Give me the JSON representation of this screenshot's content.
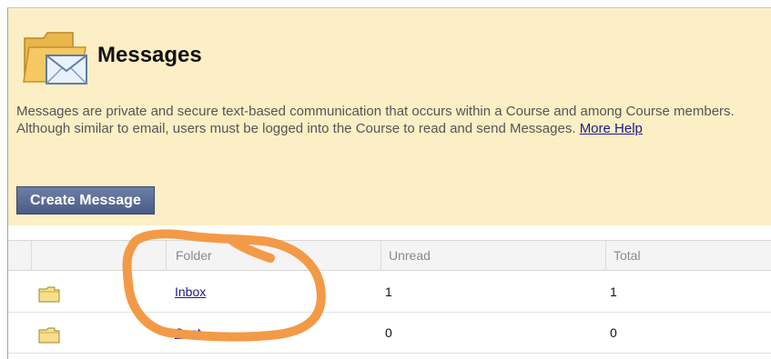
{
  "page": {
    "title": "Messages",
    "description": "Messages are private and secure text-based communication that occurs within a Course and among Course members. Although similar to email, users must be logged into the Course to read and send Messages.",
    "more_help_link": "More Help",
    "create_button": "Create Message",
    "title_icon": "folder-envelope-icon"
  },
  "table": {
    "headers": [
      "Folder",
      "Unread",
      "Total"
    ],
    "rows": [
      {
        "folder": "Inbox",
        "unread": "1",
        "total": "1",
        "icon": "folder-icon"
      },
      {
        "folder": "Sent",
        "unread": "0",
        "total": "0",
        "icon": "folder-icon"
      }
    ]
  },
  "colors": {
    "header_background": "#fcefc5",
    "button_background": "#55678f",
    "annotation_orange": "#f39a46",
    "link": "#1a1a8c"
  }
}
